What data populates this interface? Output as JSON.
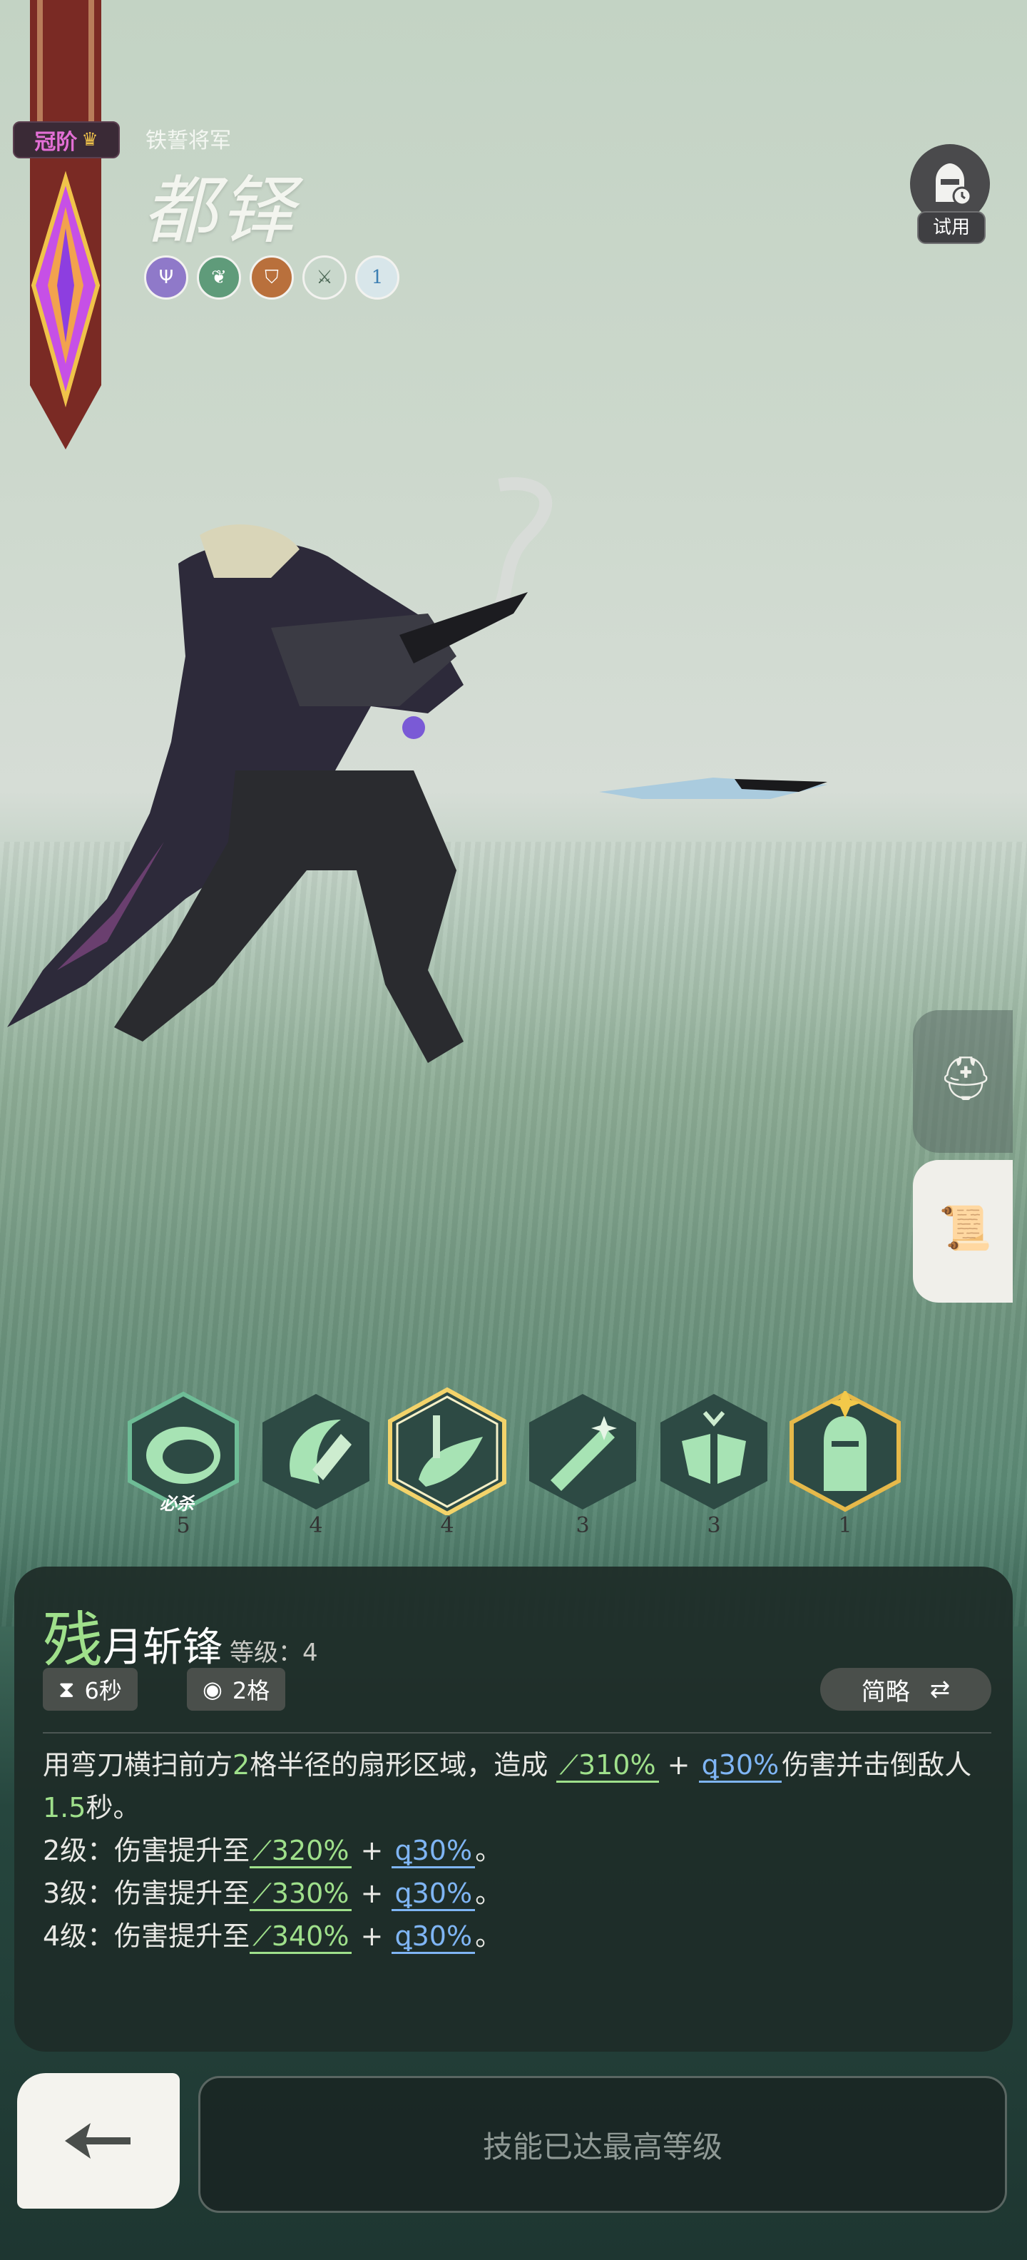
{
  "hero": {
    "tier_label": "冠阶",
    "subtitle": "铁誓将军",
    "name": "都铎",
    "traits": [
      {
        "icon": "trident-icon",
        "color": "#8f79c9"
      },
      {
        "icon": "leaf-icon",
        "color": "#5f9b7a"
      },
      {
        "icon": "shield-icon",
        "color": "#b9703c"
      },
      {
        "icon": "crossed-swords-icon",
        "color": "#c9d8cc"
      },
      {
        "icon": "number-one-icon",
        "label": "1",
        "color": "#d8e6ea"
      }
    ]
  },
  "trial": {
    "label": "试用"
  },
  "skills": [
    {
      "level": "5",
      "tag": "必杀",
      "selected": false
    },
    {
      "level": "4",
      "tag": "",
      "selected": false
    },
    {
      "level": "4",
      "tag": "",
      "selected": true
    },
    {
      "level": "3",
      "tag": "",
      "selected": false
    },
    {
      "level": "3",
      "tag": "",
      "selected": false
    },
    {
      "level": "1",
      "tag": "",
      "selected": false,
      "gold": true
    }
  ],
  "skill_detail": {
    "name_first": "残",
    "name_rest": "月斩锋",
    "level_label": "等级：",
    "level": "4",
    "cooldown": "6秒",
    "range": "2格",
    "mode_button": "简略",
    "desc_a": "用弯刀横扫前方",
    "desc_b": "2",
    "desc_c": "格半径的扇形区域，造成",
    "desc_atk": "310%",
    "desc_plus": "+",
    "desc_mag": "30%",
    "desc_d": "伤害并击倒敌人",
    "desc_e": "1.5",
    "desc_f": "秒。",
    "lines": [
      {
        "prefix": "2级：伤害提升至",
        "atk": "320%",
        "plus": "+",
        "mag": "30%",
        "end": "。"
      },
      {
        "prefix": "3级：伤害提升至",
        "atk": "330%",
        "plus": "+",
        "mag": "30%",
        "end": "。"
      },
      {
        "prefix": "4级：伤害提升至",
        "atk": "340%",
        "plus": "+",
        "mag": "30%",
        "end": "。"
      }
    ]
  },
  "footer": {
    "max_label": "技能已达最高等级"
  }
}
